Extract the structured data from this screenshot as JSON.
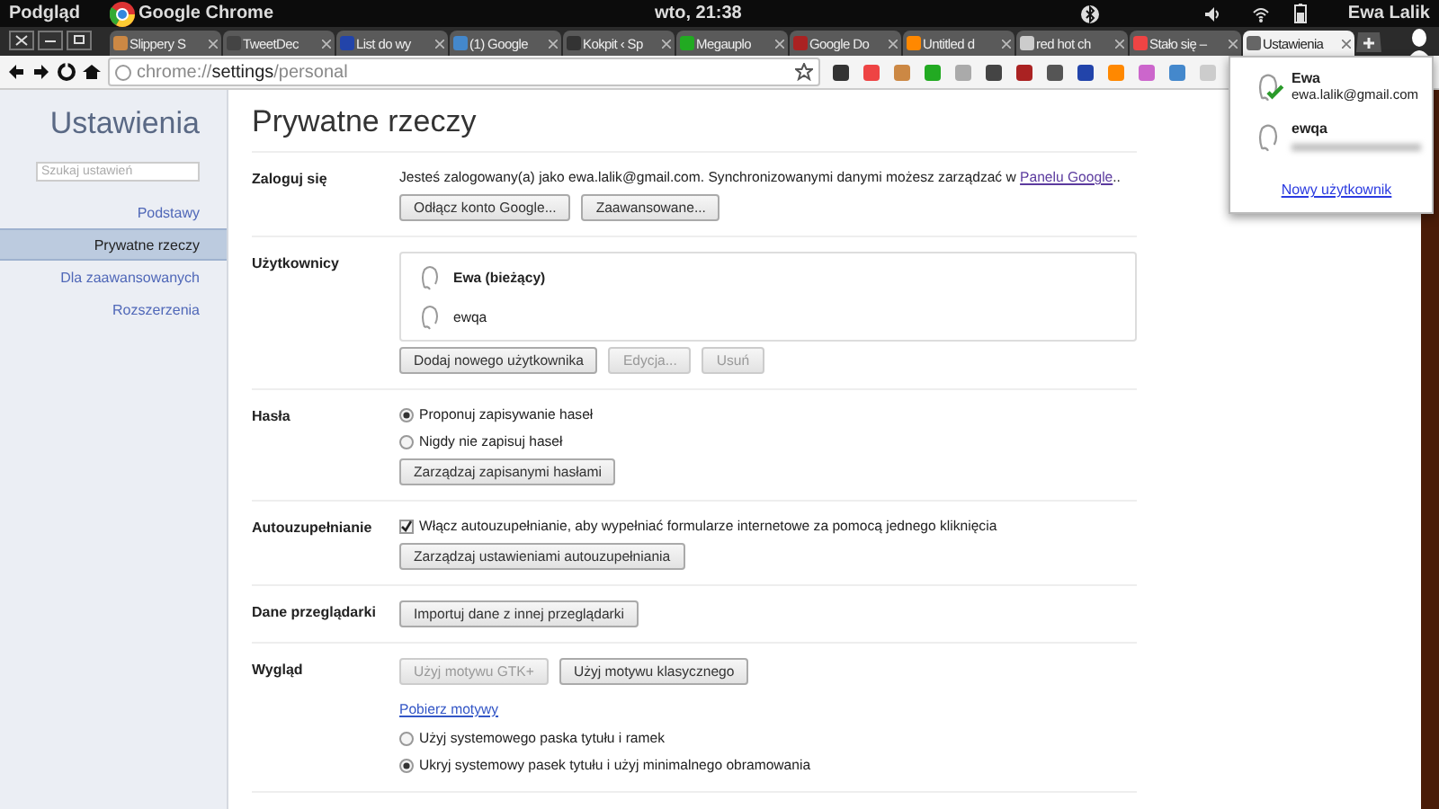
{
  "top_panel": {
    "app_name": "Podgląd",
    "window_title": "Google Chrome",
    "clock": "wto, 21:38",
    "user": "Ewa Lalik"
  },
  "tabs": [
    {
      "label": "Slippery S",
      "selected": false
    },
    {
      "label": "TweetDec",
      "selected": false
    },
    {
      "label": "List do wy",
      "selected": false
    },
    {
      "label": "(1) Google",
      "selected": false
    },
    {
      "label": "Kokpit ‹ Sp",
      "selected": false
    },
    {
      "label": "Megauplo",
      "selected": false
    },
    {
      "label": "Google Do",
      "selected": false
    },
    {
      "label": "Untitled d",
      "selected": false
    },
    {
      "label": "red hot ch",
      "selected": false
    },
    {
      "label": "Stało się –",
      "selected": false
    },
    {
      "label": "Ustawienia",
      "selected": true
    }
  ],
  "address_bar": {
    "scheme": "chrome://",
    "host": "settings",
    "path": "/personal"
  },
  "sidebar": {
    "title": "Ustawienia",
    "search": {
      "placeholder": "Szukaj ustawień"
    },
    "items": [
      {
        "label": "Podstawy",
        "selected": false
      },
      {
        "label": "Prywatne rzeczy",
        "selected": true
      },
      {
        "label": "Dla zaawansowanych",
        "selected": false
      },
      {
        "label": "Rozszerzenia",
        "selected": false
      }
    ]
  },
  "page": {
    "title": "Prywatne rzeczy",
    "sections": [
      {
        "label": "Zaloguj się",
        "rows": [
          {
            "kind": "text",
            "text": "Jesteś zalogowany(a) jako ewa.lalik@gmail.com. Synchronizowanymi danymi możesz zarządzać w ",
            "link": "Panelu Google",
            "after": ".."
          },
          {
            "kind": "buttons",
            "buttons": [
              {
                "label": "Odłącz konto Google...",
                "disabled": false
              },
              {
                "label": "Zaawansowane...",
                "disabled": false
              }
            ]
          }
        ]
      },
      {
        "label": "Użytkownicy",
        "rows": [
          {
            "kind": "users",
            "users": [
              {
                "name": "Ewa (bieżący)",
                "current": true
              },
              {
                "name": "ewqa",
                "current": false
              }
            ]
          },
          {
            "kind": "buttons",
            "buttons": [
              {
                "label": "Dodaj nowego użytkownika",
                "disabled": false
              },
              {
                "label": "Edycja...",
                "disabled": true
              },
              {
                "label": "Usuń",
                "disabled": true
              }
            ]
          }
        ]
      },
      {
        "label": "Hasła",
        "rows": [
          {
            "kind": "radio",
            "label": "Proponuj zapisywanie haseł",
            "selected": true
          },
          {
            "kind": "radio",
            "label": "Nigdy nie zapisuj haseł",
            "selected": false
          },
          {
            "kind": "buttons",
            "buttons": [
              {
                "label": "Zarządzaj zapisanymi hasłami",
                "disabled": false
              }
            ]
          }
        ]
      },
      {
        "label": "Autouzupełnianie",
        "rows": [
          {
            "kind": "checkbox",
            "label": "Włącz autouzupełnianie, aby wypełniać formularze internetowe za pomocą jednego kliknięcia",
            "checked": true
          },
          {
            "kind": "buttons",
            "buttons": [
              {
                "label": "Zarządzaj ustawieniami autouzupełniania",
                "disabled": false
              }
            ]
          }
        ]
      },
      {
        "label": "Dane przeglądarki",
        "rows": [
          {
            "kind": "buttons",
            "buttons": [
              {
                "label": "Importuj dane z innej przeglądarki",
                "disabled": false
              }
            ]
          }
        ]
      },
      {
        "label": "Wygląd",
        "rows": [
          {
            "kind": "buttons",
            "buttons": [
              {
                "label": "Użyj motywu GTK+",
                "disabled": true
              },
              {
                "label": "Użyj motywu klasycznego",
                "disabled": false
              }
            ]
          },
          {
            "kind": "link",
            "label": "Pobierz motywy"
          },
          {
            "kind": "radio",
            "label": "Użyj systemowego paska tytułu i ramek",
            "selected": false
          },
          {
            "kind": "radio",
            "label": "Ukryj systemowy pasek tytułu i użyj minimalnego obramowania",
            "selected": true
          }
        ]
      }
    ]
  },
  "profile_menu": {
    "users": [
      {
        "name": "Ewa",
        "email": "ewa.lalik@gmail.com",
        "signed_in": true
      },
      {
        "name": "ewqa",
        "signed_in": false,
        "redacted": true
      }
    ],
    "new_user_link": "Nowy użytkownik"
  }
}
